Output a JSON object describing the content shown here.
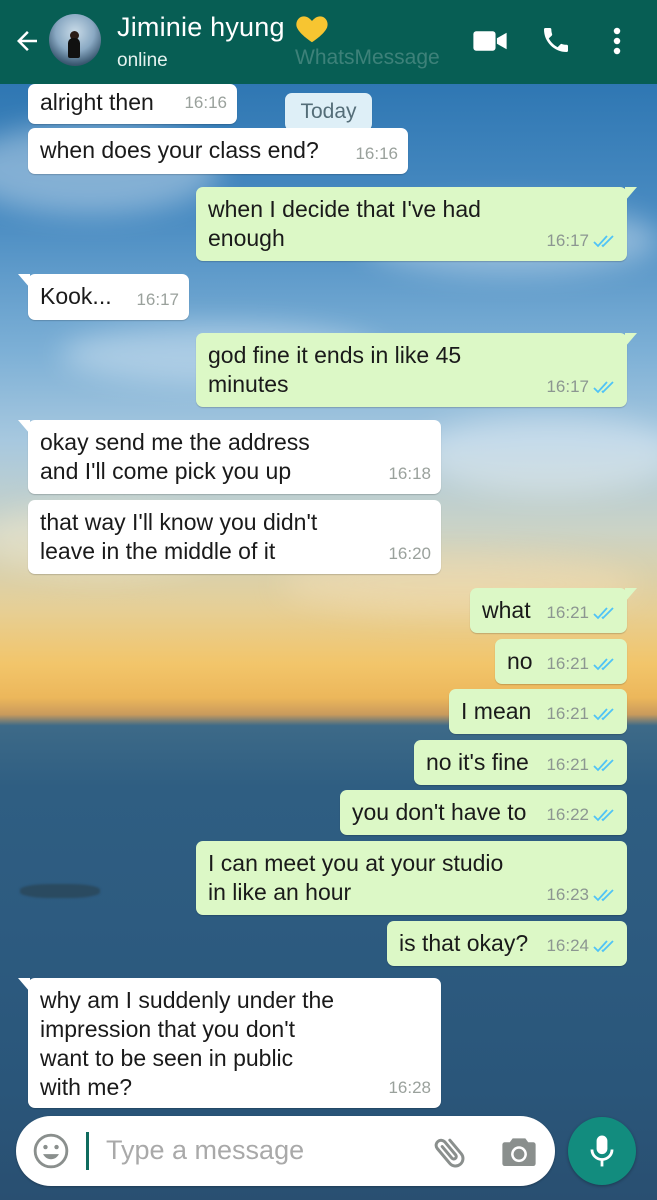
{
  "header": {
    "contact_name": "Jiminie hyung",
    "status": "online",
    "watermark": "WhatsMessage",
    "heart_color": "#f7c531",
    "icons": [
      "back-arrow-icon",
      "video-call-icon",
      "phone-icon",
      "more-vert-icon"
    ]
  },
  "date_chip": "Today",
  "messages": [
    {
      "dir": "in",
      "text": "alright then",
      "time": "16:16"
    },
    {
      "dir": "in",
      "text": "when does your class end?",
      "time": "16:16"
    },
    {
      "dir": "out",
      "text": "when I decide that I've had\nenough",
      "time": "16:17",
      "read": true
    },
    {
      "dir": "in",
      "text": "Kook...",
      "time": "16:17"
    },
    {
      "dir": "out",
      "text": "god fine it ends in like 45\nminutes",
      "time": "16:17",
      "read": true
    },
    {
      "dir": "in",
      "text": "okay send me the address\nand I'll come pick you up",
      "time": "16:18"
    },
    {
      "dir": "in",
      "text": "that way I'll know you didn't\nleave in the middle of it",
      "time": "16:20"
    },
    {
      "dir": "out",
      "text": "what",
      "time": "16:21",
      "read": true
    },
    {
      "dir": "out",
      "text": "no",
      "time": "16:21",
      "read": true
    },
    {
      "dir": "out",
      "text": "I mean",
      "time": "16:21",
      "read": true
    },
    {
      "dir": "out",
      "text": "no it's fine",
      "time": "16:21",
      "read": true
    },
    {
      "dir": "out",
      "text": "you don't have to",
      "time": "16:22",
      "read": true
    },
    {
      "dir": "out",
      "text": "I can meet you at your studio\nin like an hour",
      "time": "16:23",
      "read": true
    },
    {
      "dir": "out",
      "text": "is that okay?",
      "time": "16:24",
      "read": true
    },
    {
      "dir": "in",
      "text": "why am I suddenly under the\nimpression that you don't\nwant to be seen in public\nwith me?",
      "time": "16:28"
    }
  ],
  "composer": {
    "placeholder": "Type a message",
    "icons": [
      "emoji-icon",
      "attach-icon",
      "camera-icon",
      "mic-icon"
    ]
  },
  "colors": {
    "header": "#075e54",
    "incoming_bubble": "#ffffff",
    "outgoing_bubble": "#dcf8c6",
    "read_tick": "#4fc3f7",
    "mic_button": "#128c7e"
  }
}
